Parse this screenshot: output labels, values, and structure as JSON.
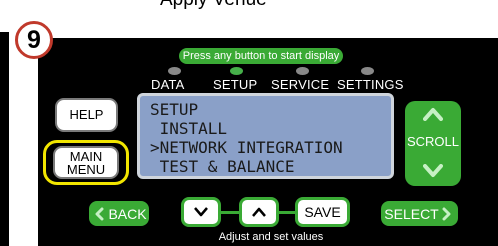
{
  "caption_top": "Apply Venue",
  "step_number": "9",
  "status_pill": "Press any button to start display",
  "modes": [
    {
      "label": "DATA",
      "active": false
    },
    {
      "label": "SETUP",
      "active": true
    },
    {
      "label": "SERVICE",
      "active": false
    },
    {
      "label": "SETTINGS",
      "active": false
    }
  ],
  "lcd_lines": [
    "SETUP",
    " INSTALL",
    ">NETWORK INTEGRATION",
    " TEST & BALANCE"
  ],
  "buttons": {
    "help": "HELP",
    "main_menu_line1": "MAIN",
    "main_menu_line2": "MENU",
    "scroll": "SCROLL",
    "back": "BACK",
    "save": "SAVE",
    "select": "SELECT"
  },
  "caption_bottom": "Adjust and set values",
  "colors": {
    "accent_green": "#3aaa35",
    "lcd_blue": "#8aa0c8",
    "highlight_yellow": "#f2e600",
    "badge_red": "#c0392b"
  },
  "icons": {
    "scroll_up": "chevron-up-icon",
    "scroll_down": "chevron-down-icon",
    "back": "chevron-left-icon",
    "select": "chevron-right-icon",
    "down_button": "chevron-down-icon",
    "up_button": "chevron-up-icon"
  }
}
